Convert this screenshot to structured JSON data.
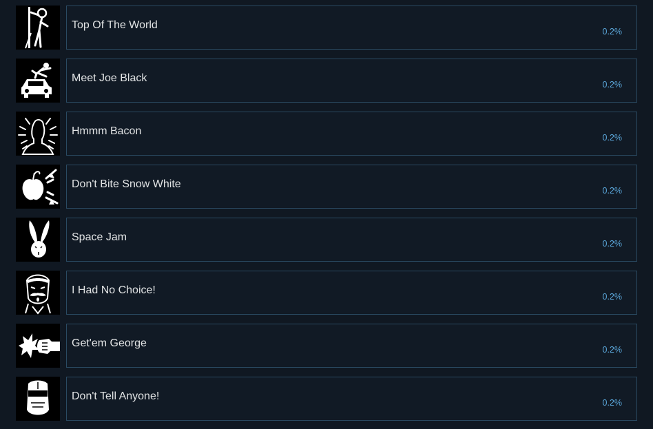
{
  "achievements": [
    {
      "name": "Top Of The World",
      "percent": "0.2%",
      "icon": "pole-climber-icon"
    },
    {
      "name": "Meet Joe Black",
      "percent": "0.2%",
      "icon": "car-crash-icon"
    },
    {
      "name": "Hmmm Bacon",
      "percent": "0.2%",
      "icon": "sniffing-head-icon"
    },
    {
      "name": "Don't Bite Snow White",
      "percent": "0.2%",
      "icon": "poison-apple-icon"
    },
    {
      "name": "Space Jam",
      "percent": "0.2%",
      "icon": "bunny-ears-icon"
    },
    {
      "name": "I Had No Choice!",
      "percent": "0.2%",
      "icon": "mustache-man-icon"
    },
    {
      "name": "Get'em George",
      "percent": "0.2%",
      "icon": "punch-fist-icon"
    },
    {
      "name": "Don't Tell Anyone!",
      "percent": "0.2%",
      "icon": "robot-helmet-icon"
    }
  ]
}
